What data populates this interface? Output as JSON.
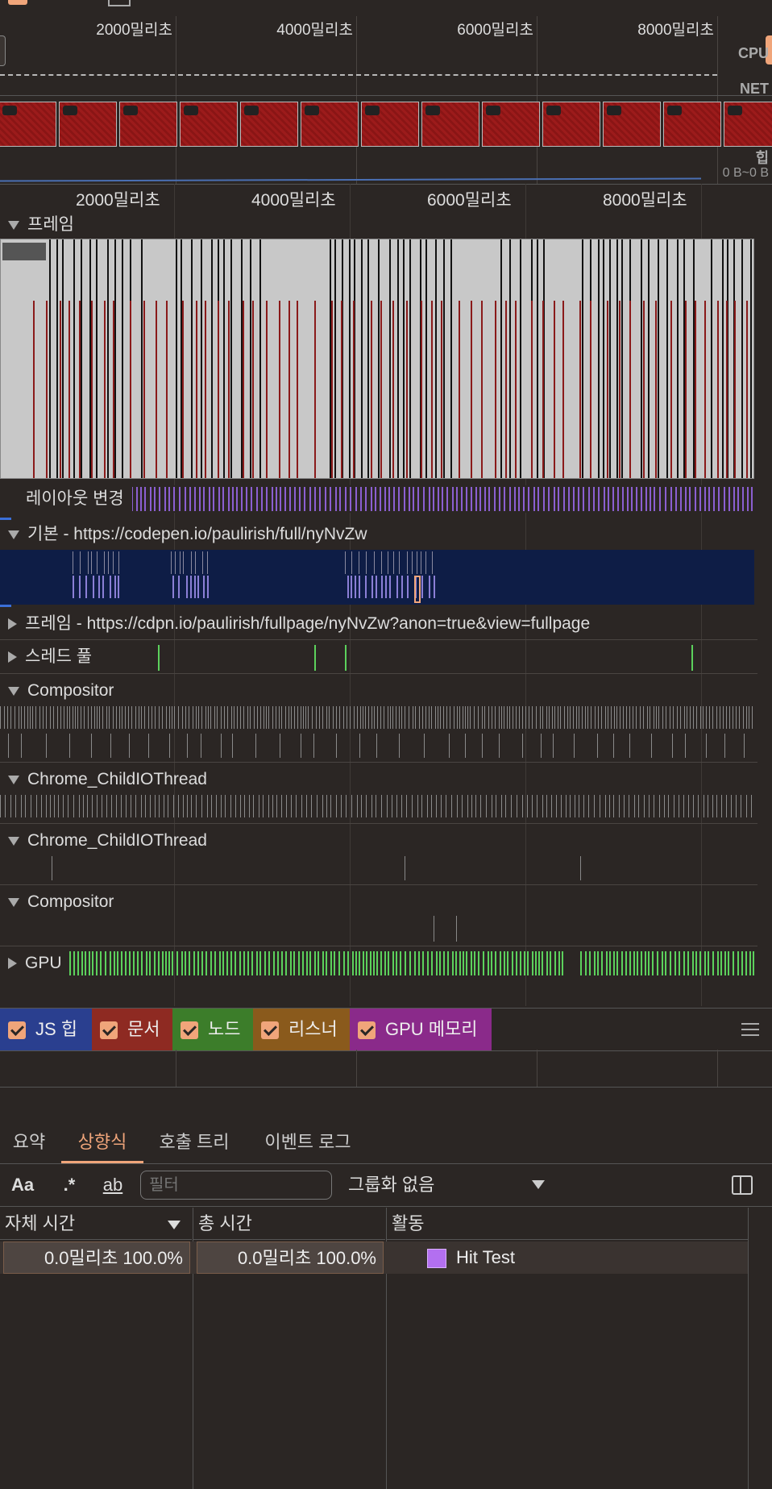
{
  "overview": {
    "ticks": [
      "2000밀리초",
      "4000밀리초",
      "6000밀리초",
      "8000밀리초"
    ],
    "labels": {
      "cpu": "CPU",
      "net": "NET",
      "heap": "힙",
      "heap_range": "0 B~0 B"
    }
  },
  "ruler": {
    "ticks": [
      "2000밀리초",
      "4000밀리초",
      "6000밀리초",
      "8000밀리초"
    ]
  },
  "tracks": {
    "frames": "프레임",
    "layout_shifts": "레이아웃 변경",
    "main": "기본 - https://codepen.io/paulirish/full/nyNvZw",
    "subframe": "프레임 - https://cdpn.io/paulirish/fullpage/nyNvZw?anon=true&view=fullpage",
    "thread_pool": "스레드 풀",
    "compositor1": "Compositor",
    "io1": "Chrome_ChildIOThread",
    "io2": "Chrome_ChildIOThread",
    "compositor2": "Compositor",
    "gpu": "GPU"
  },
  "legend": {
    "items": [
      {
        "label": "JS 힙",
        "color": "#2a3f8f",
        "checked": true
      },
      {
        "label": "문서",
        "color": "#8e2a22",
        "checked": true
      },
      {
        "label": "노드",
        "color": "#3c7d2a",
        "checked": true
      },
      {
        "label": "리스너",
        "color": "#8a5a1c",
        "checked": true
      },
      {
        "label": "GPU 메모리",
        "color": "#8a2a8a",
        "checked": true
      }
    ],
    "menu_icon": "hamburger-icon"
  },
  "tabs": [
    {
      "label": "요약",
      "active": false
    },
    {
      "label": "상향식",
      "active": true
    },
    {
      "label": "호출 트리",
      "active": false
    },
    {
      "label": "이벤트 로그",
      "active": false
    }
  ],
  "toolbar": {
    "match_case": "Aa",
    "regex": ".*",
    "whole_word": "ab",
    "filter_placeholder": "필터",
    "grouping": "그룹화 없음",
    "sidebar_icon": "sidebar-toggle-icon"
  },
  "table": {
    "headers": {
      "self_time": "자체 시간",
      "total_time": "총 시간",
      "activity": "활동"
    },
    "rows": [
      {
        "self_time": "0.0밀리초",
        "self_pct": "100.0%",
        "total_time": "0.0밀리초",
        "total_pct": "100.0%",
        "activity": "Hit Test",
        "color": "#b36ff0"
      }
    ]
  }
}
